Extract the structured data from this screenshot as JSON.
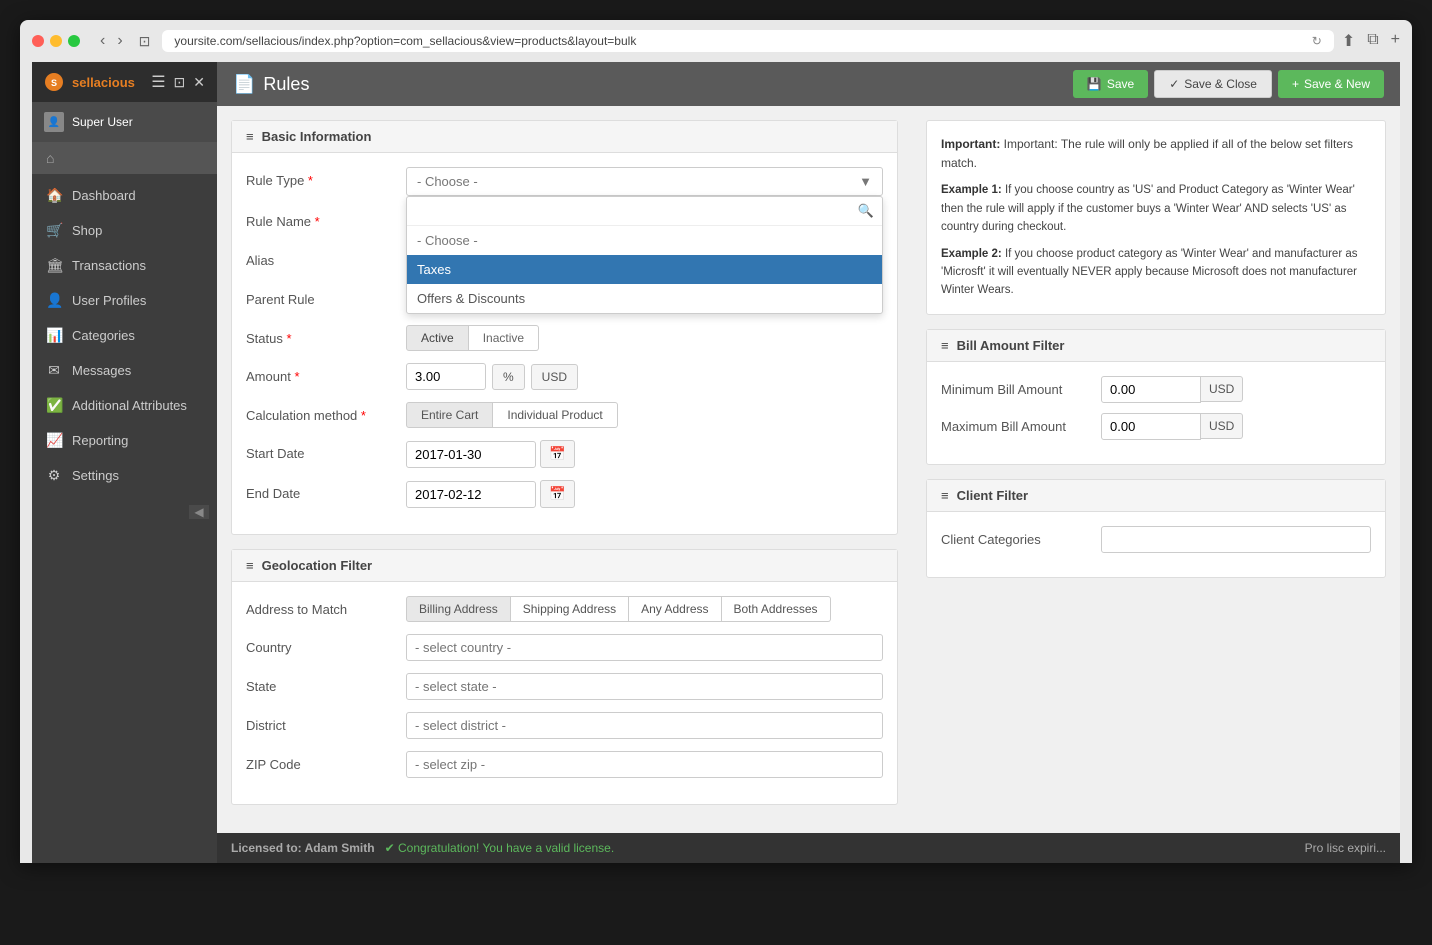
{
  "browser": {
    "url": "yoursite.com/sellacious/index.php?option=com_sellacious&view=products&layout=bulk"
  },
  "app": {
    "logo": "sellacious",
    "user": "Super User"
  },
  "sidebar": {
    "items": [
      {
        "id": "dashboard",
        "label": "Dashboard",
        "icon": "🏠"
      },
      {
        "id": "shop",
        "label": "Shop",
        "icon": "🛍"
      },
      {
        "id": "transactions",
        "label": "Transactions",
        "icon": "🏛"
      },
      {
        "id": "user-profiles",
        "label": "User Profiles",
        "icon": "👤"
      },
      {
        "id": "categories",
        "label": "Categories",
        "icon": "📊"
      },
      {
        "id": "messages",
        "label": "Messages",
        "icon": "✉"
      },
      {
        "id": "additional-attributes",
        "label": "Additional Attributes",
        "icon": "✅"
      },
      {
        "id": "reporting",
        "label": "Reporting",
        "icon": "📈"
      },
      {
        "id": "settings",
        "label": "Settings",
        "icon": "⚙"
      }
    ]
  },
  "page": {
    "title": "Rules",
    "icon": "📄"
  },
  "toolbar": {
    "save_label": "Save",
    "save_close_label": "Save & Close",
    "save_new_label": "Save & New"
  },
  "basic_info": {
    "section_label": "Basic Information",
    "rule_type": {
      "label": "Rule Type",
      "placeholder": "- Choose -",
      "options": [
        "- Choose -",
        "Taxes",
        "Offers & Discounts"
      ],
      "selected_option": "Taxes"
    },
    "rule_name": {
      "label": "Rule Name",
      "value": ""
    },
    "alias": {
      "label": "Alias",
      "value": ""
    },
    "parent_rule": {
      "label": "Parent Rule",
      "value": ""
    },
    "status": {
      "label": "Status",
      "active_label": "Active",
      "inactive_label": "Inactive",
      "selected": "Active"
    },
    "amount": {
      "label": "Amount",
      "value": "3.00",
      "percent_label": "%",
      "usd_label": "USD"
    },
    "calculation_method": {
      "label": "Calculation method",
      "entire_cart_label": "Entire Cart",
      "individual_product_label": "Individual Product",
      "selected": "Entire Cart"
    },
    "start_date": {
      "label": "Start Date",
      "value": "2017-01-30"
    },
    "end_date": {
      "label": "End Date",
      "value": "2017-02-12"
    }
  },
  "info_panel": {
    "line1": "Important: The rule will only be applied if all of the below set filters match.",
    "line2_label": "Example 1:",
    "line2": " If you choose country as 'US' and Product Category as 'Winter Wear' then the rule will apply if the customer buys a 'Winter Wear' AND selects 'US' as country during checkout.",
    "line3_label": "Example 2:",
    "line3": " If you choose product category as 'Winter Wear' and manufacturer as 'Microsft' it will eventually NEVER apply because Microsoft does not manufacturer Winter Wears."
  },
  "bill_amount_filter": {
    "section_label": "Bill Amount Filter",
    "min_label": "Minimum Bill Amount",
    "min_value": "0.00",
    "max_label": "Maximum Bill Amount",
    "max_value": "0.00",
    "currency": "USD"
  },
  "client_filter": {
    "section_label": "Client Filter",
    "categories_label": "Client Categories"
  },
  "geolocation_filter": {
    "section_label": "Geolocation Filter",
    "address_to_match_label": "Address to Match",
    "billing_address": "Billing Address",
    "shipping_address": "Shipping Address",
    "any_address": "Any Address",
    "both_addresses": "Both Addresses",
    "selected_address": "Billing Address",
    "country_label": "Country",
    "country_placeholder": "- select country -",
    "state_label": "State",
    "state_placeholder": "- select state -",
    "district_label": "District",
    "district_placeholder": "- select district -",
    "zip_label": "ZIP Code",
    "zip_placeholder": "- select zip -"
  },
  "footer": {
    "licensed_to": "Licensed to: Adam Smith",
    "congratulations": "Congratulation! You have a valid license.",
    "pro": "Pro lisc expiri..."
  }
}
